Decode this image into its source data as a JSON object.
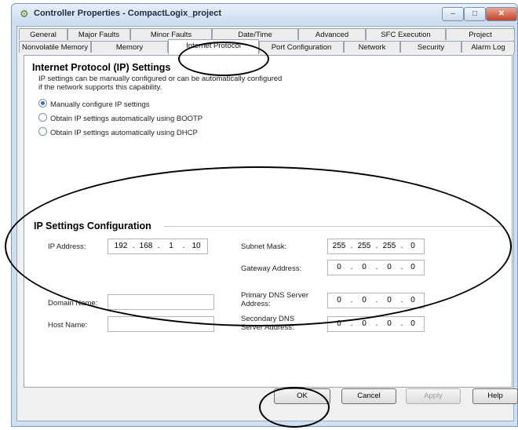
{
  "window": {
    "title": "Controller Properties - CompactLogix_project",
    "minimize_label": "–",
    "maximize_label": "□",
    "close_label": "✕",
    "app_icon": "gear-icon"
  },
  "tabs": {
    "row1": [
      "General",
      "Major Faults",
      "Minor Faults",
      "Date/Time",
      "Advanced",
      "SFC Execution",
      "Project"
    ],
    "row2": [
      "Nonvolatile Memory",
      "Memory",
      "Internet Protocol",
      "Port Configuration",
      "Network",
      "Security",
      "Alarm Log"
    ],
    "active": "Internet Protocol"
  },
  "ip_settings": {
    "heading": "Internet Protocol (IP) Settings",
    "description_line1": "IP settings can be manually configured or can be automatically configured",
    "description_line2": "if the network supports this capability.",
    "options": [
      {
        "label": "Manually configure IP settings",
        "selected": true
      },
      {
        "label": "Obtain IP settings automatically using BOOTP",
        "selected": false
      },
      {
        "label": "Obtain IP settings automatically using DHCP",
        "selected": false
      }
    ]
  },
  "ip_config": {
    "heading": "IP Settings Configuration",
    "ip_address_label": "IP Address:",
    "ip_address": [
      "192",
      "168",
      "1",
      "10"
    ],
    "subnet_mask_label": "Subnet Mask:",
    "subnet_mask": [
      "255",
      "255",
      "255",
      "0"
    ],
    "gateway_label": "Gateway Address:",
    "gateway": [
      "0",
      "0",
      "0",
      "0"
    ],
    "domain_name_label": "Domain Name:",
    "domain_name": "",
    "host_name_label": "Host Name:",
    "host_name": "",
    "primary_dns_label_line1": "Primary DNS Server",
    "primary_dns_label_line2": "Address:",
    "primary_dns": [
      "0",
      "0",
      "0",
      "0"
    ],
    "secondary_dns_label_line1": "Secondary DNS",
    "secondary_dns_label_line2": "Server Address:",
    "secondary_dns": [
      "0",
      "0",
      "0",
      "0"
    ]
  },
  "buttons": {
    "ok": "OK",
    "cancel": "Cancel",
    "apply": "Apply",
    "help": "Help"
  }
}
